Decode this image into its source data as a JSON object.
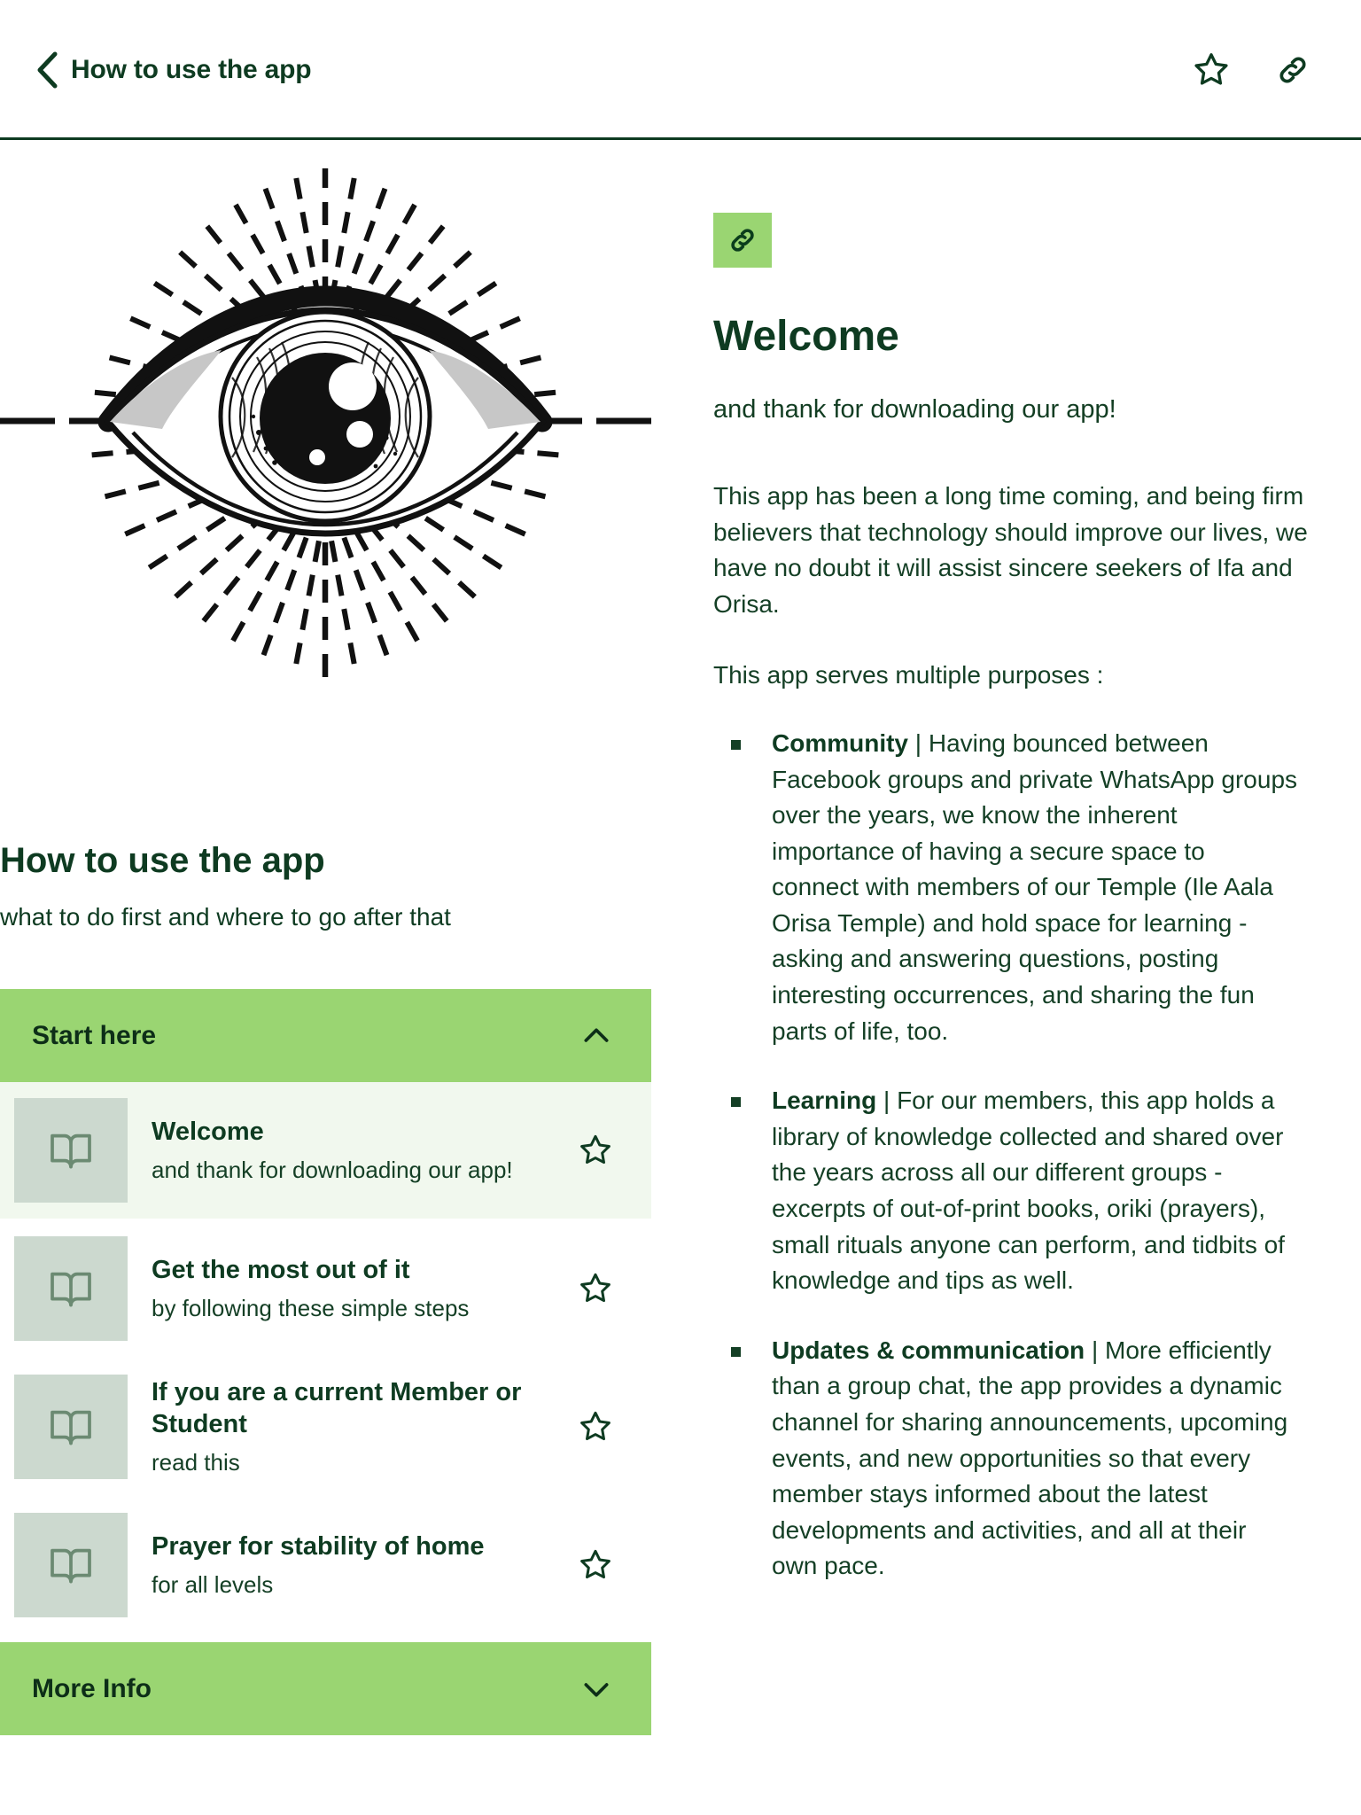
{
  "topbar": {
    "back_icon": "chevron-left-icon",
    "title": "How to use the app",
    "star_icon": "star-outline-icon",
    "link_icon": "link-icon"
  },
  "colors": {
    "brand_dark_green": "#0e3b21",
    "accent_green": "#9ad572",
    "selected_row": "#f1f8ee",
    "thumb_bg": "#ccd9cf",
    "book_icon": "#6b8a72"
  },
  "left": {
    "hero_icon": "all-seeing-eye-illustration",
    "title": "How to use the app",
    "subtitle": "what to do first and where to go after that",
    "sections": [
      {
        "label": "Start here",
        "expanded": true,
        "chevron": "chevron-up-icon",
        "items": [
          {
            "icon": "book-icon",
            "title": "Welcome",
            "subtitle": "and thank for downloading our app!",
            "star": "star-outline-icon",
            "selected": true
          },
          {
            "icon": "book-icon",
            "title": "Get the most out of it",
            "subtitle": "by following these simple steps",
            "star": "star-outline-icon",
            "selected": false
          },
          {
            "icon": "book-icon",
            "title": "If you are a current Member or Student",
            "subtitle": "read this",
            "star": "star-outline-icon",
            "selected": false
          },
          {
            "icon": "book-icon",
            "title": "Prayer for stability of home",
            "subtitle": "for all levels",
            "star": "star-outline-icon",
            "selected": false
          }
        ]
      },
      {
        "label": "More Info",
        "expanded": false,
        "chevron": "chevron-down-icon",
        "items": []
      }
    ]
  },
  "right": {
    "badge_icon": "link-icon",
    "title": "Welcome",
    "subtitle": "and thank for downloading our app!",
    "paragraph_1": "This app has been a long time coming, and being firm believers that technology should improve our lives, we have no doubt it will assist sincere seekers of Ifa and Orisa.",
    "paragraph_2": "This app serves multiple purposes :",
    "bullets": [
      {
        "term": "Community",
        "separator": " | ",
        "text": "Having bounced between Facebook groups and private WhatsApp groups over the years, we know the inherent importance of having a secure space to connect with members of our Temple (Ile Aala Orisa Temple) and hold space for learning - asking and answering questions, posting interesting occurrences, and sharing the fun parts of life, too."
      },
      {
        "term": "Learning",
        "separator": " | ",
        "text": "For our members, this app holds a library of knowledge collected and shared over the years across all our different groups - excerpts of out-of-print books, oriki (prayers), small rituals anyone can perform, and tidbits of knowledge and tips as well."
      },
      {
        "term": "Updates & communication",
        "separator": " | ",
        "text": "More efficiently than a group chat, the app provides a dynamic channel for sharing announcements, upcoming events, and new opportunities so that every member stays informed about the latest developments and activities, and all at their own pace."
      }
    ]
  }
}
